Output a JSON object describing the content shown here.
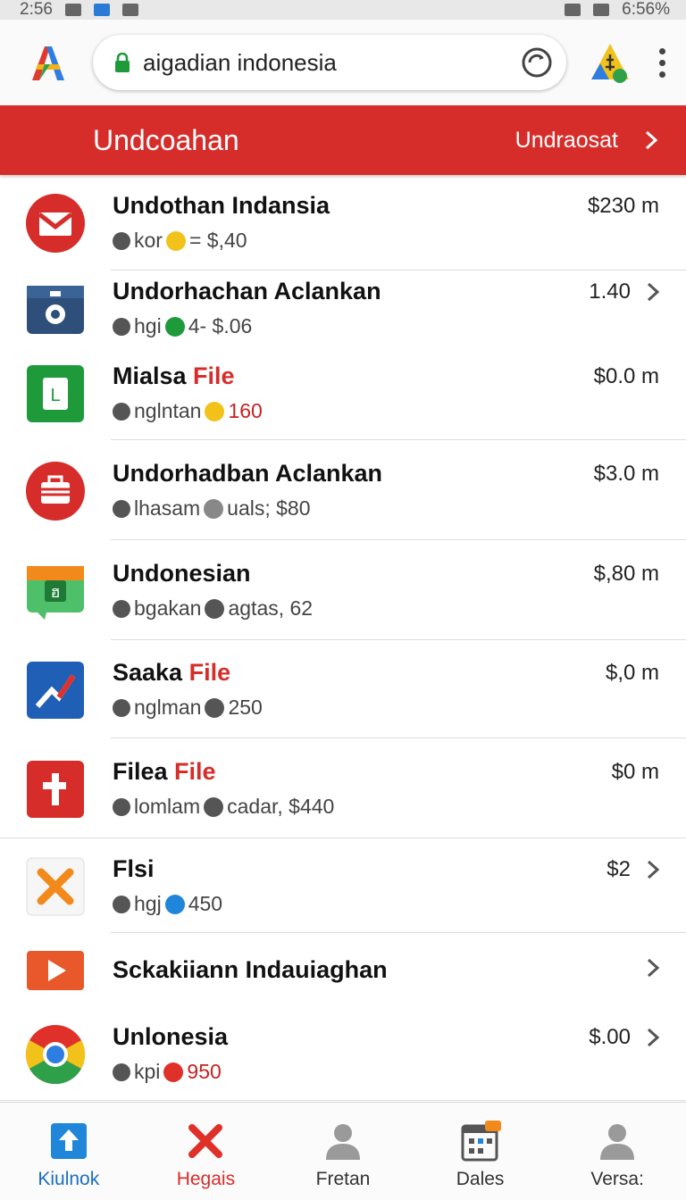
{
  "status_bar": {
    "time": "2:56",
    "battery": "6:56%"
  },
  "toolbar": {
    "url": "aigadian indonesia"
  },
  "banner": {
    "title": "Undcoahan",
    "action": "Undraosat"
  },
  "items": [
    {
      "title": "Undothan Indansia",
      "title_accent": "",
      "sub_a": "kor",
      "sub_b": "= $,40",
      "sub_b_red": false,
      "value": "$230 m",
      "chevron": false,
      "icon": "gmail-icon"
    },
    {
      "title": "Undorhachan Aclankan",
      "title_accent": "",
      "sub_a": "hgi",
      "sub_b": "4- $.06",
      "sub_b_red": false,
      "value": "1.40",
      "chevron": true,
      "icon": "camera-app-icon"
    },
    {
      "title": "Mialsa ",
      "title_accent": "File",
      "sub_a": "nglntan",
      "sub_b": "160",
      "sub_b_red": true,
      "value": "$0.0 m",
      "chevron": false,
      "icon": "green-doc-icon"
    },
    {
      "title": "Undorhadban Aclankan",
      "title_accent": "",
      "sub_a": "lhasam",
      "sub_b": "uals; $80",
      "sub_b_red": false,
      "value": "$3.0 m",
      "chevron": false,
      "icon": "red-briefcase-icon"
    },
    {
      "title": "Undonesian",
      "title_accent": "",
      "sub_a": "bgakan",
      "sub_b": "agtas, 62",
      "sub_b_red": false,
      "value": "$,80 m",
      "chevron": false,
      "icon": "green-chat-icon"
    },
    {
      "title": "Saaka ",
      "title_accent": "File",
      "sub_a": "nglman",
      "sub_b": "250",
      "sub_b_red": false,
      "value": "$,0 m",
      "chevron": false,
      "icon": "blue-chart-icon"
    },
    {
      "title": "Filea ",
      "title_accent": "File",
      "sub_a": "lomlam",
      "sub_b": "cadar, $440",
      "sub_b_red": false,
      "value": "$0 m",
      "chevron": false,
      "icon": "red-plus-icon"
    },
    {
      "title": "Flsi",
      "title_accent": "",
      "sub_a": "hgj",
      "sub_b": "450",
      "sub_b_red": false,
      "value": "$2",
      "chevron": true,
      "icon": "orange-cross-icon"
    },
    {
      "title": "Sckakiiann Indauiaghan",
      "title_accent": "",
      "sub_a": "",
      "sub_b": "",
      "sub_b_red": false,
      "value": "",
      "chevron": true,
      "icon": "play-icon"
    },
    {
      "title": "Unlonesia",
      "title_accent": "",
      "sub_a": "kpi",
      "sub_b": "950",
      "sub_b_red": true,
      "value": "$.00",
      "chevron": true,
      "icon": "chrome-icon"
    }
  ],
  "bottom_nav": [
    {
      "label": "Kiulnok",
      "icon": "upload-icon"
    },
    {
      "label": "Hegais",
      "icon": "close-icon"
    },
    {
      "label": "Fretan",
      "icon": "person-icon"
    },
    {
      "label": "Dales",
      "icon": "calendar-icon"
    },
    {
      "label": "Versa:",
      "icon": "person-icon"
    }
  ],
  "colors": {
    "brand_red": "#d62d2a",
    "nav_blue": "#1a6ec4"
  }
}
